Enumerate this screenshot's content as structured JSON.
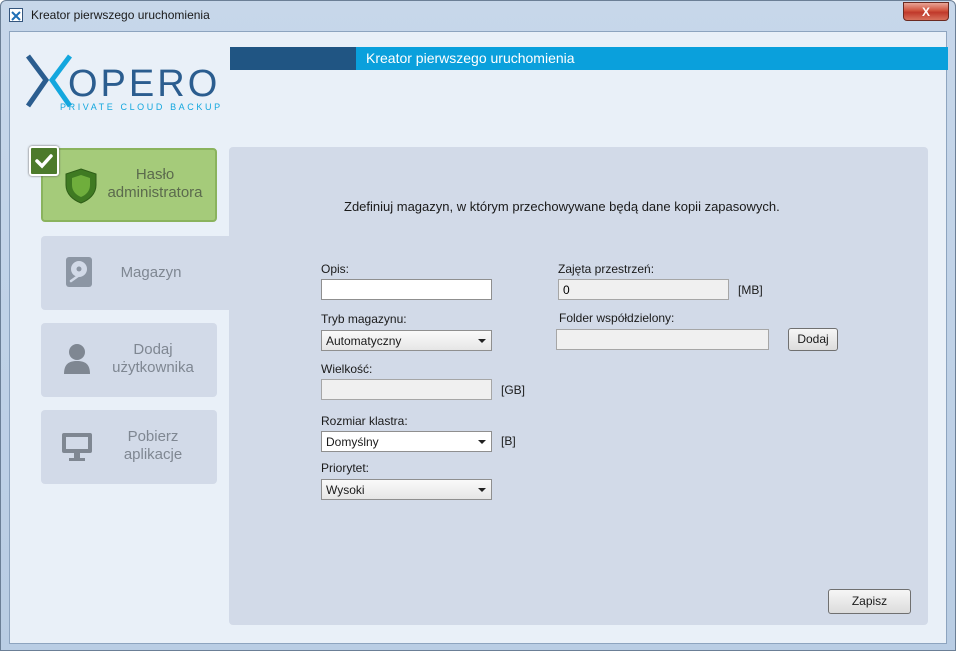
{
  "window": {
    "title": "Kreator pierwszego uruchomienia",
    "close_glyph": "X"
  },
  "logo": {
    "name": "XOPERO",
    "tagline": "PRIVATE CLOUD BACKUP"
  },
  "header": {
    "title": "Kreator pierwszego uruchomienia"
  },
  "nav": {
    "items": [
      {
        "line1": "Hasło",
        "line2": "administratora",
        "icon": "shield-icon",
        "status": "done"
      },
      {
        "line1": "Magazyn",
        "line2": "",
        "icon": "hard-drive-icon",
        "status": "active"
      },
      {
        "line1": "Dodaj",
        "line2": "użytkownika",
        "icon": "user-icon",
        "status": "pending"
      },
      {
        "line1": "Pobierz",
        "line2": "aplikacje",
        "icon": "monitor-icon",
        "status": "pending"
      }
    ]
  },
  "form": {
    "intro": "Zdefiniuj magazyn, w którym przechowywane będą dane kopii zapasowych.",
    "opis": {
      "label": "Opis:",
      "value": ""
    },
    "tryb": {
      "label": "Tryb magazynu:",
      "value": "Automatyczny"
    },
    "wielkosc": {
      "label": "Wielkość:",
      "value": "",
      "unit": "[GB]"
    },
    "rozmiar": {
      "label": "Rozmiar klastra:",
      "value": "Domyślny",
      "unit": "[B]"
    },
    "priorytet": {
      "label": "Priorytet:",
      "value": "Wysoki"
    },
    "zajeta": {
      "label": "Zajęta przestrzeń:",
      "value": "0",
      "unit": "[MB]"
    },
    "folder": {
      "label": "Folder współdzielony:",
      "value": "",
      "button": "Dodaj"
    },
    "save_button": "Zapisz"
  },
  "colors": {
    "accent": "#0aa0dc",
    "accent_dark": "#205583",
    "done_green": "#a5cb7a",
    "panel": "#d2dae8"
  }
}
